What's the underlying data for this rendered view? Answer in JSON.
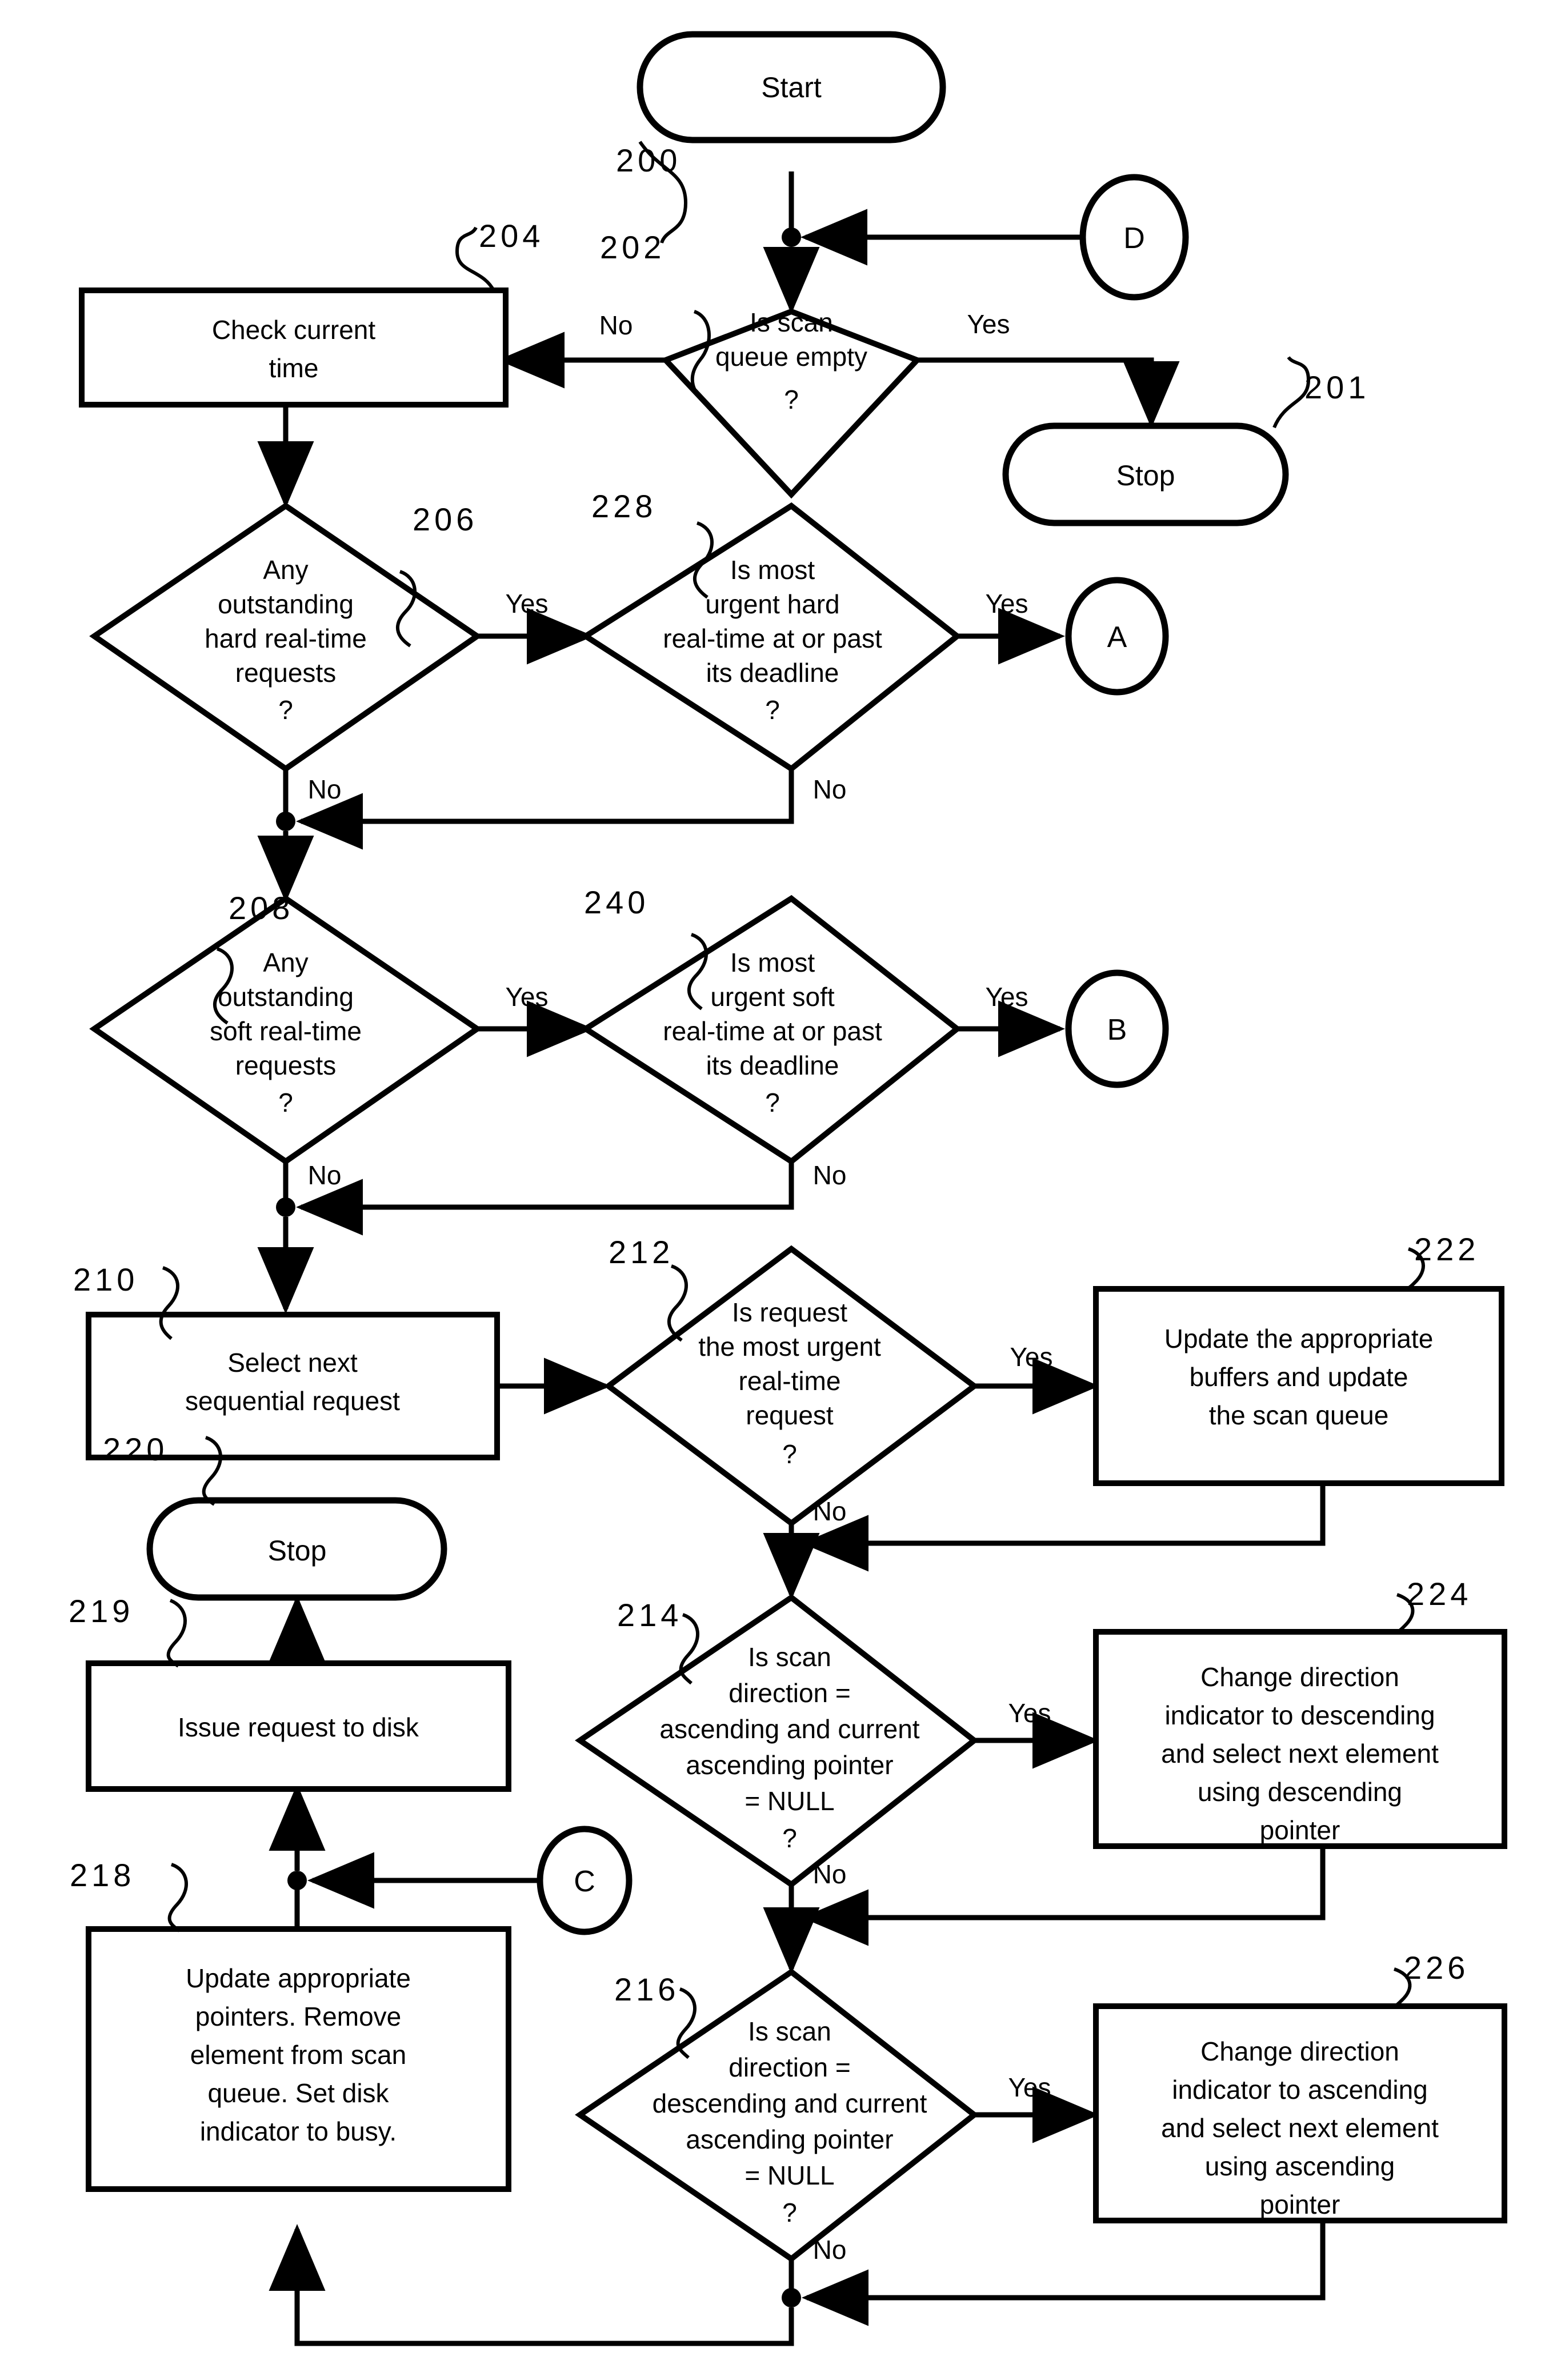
{
  "figure": {
    "type": "patent-flowchart",
    "title": "Disk request scheduling flowchart"
  },
  "nodes": {
    "start": {
      "ref": "200",
      "label": "Start",
      "shape": "terminator"
    },
    "stop_201": {
      "ref": "201",
      "label": "Stop",
      "shape": "terminator"
    },
    "d_connector": {
      "label": "D",
      "shape": "connector"
    },
    "dec_202": {
      "ref": "202",
      "shape": "decision",
      "lines": [
        "Is scan",
        "queue empty",
        "?"
      ]
    },
    "proc_204": {
      "ref": "204",
      "shape": "process",
      "lines": [
        "Check current",
        "time"
      ]
    },
    "dec_206": {
      "ref": "206",
      "shape": "decision",
      "lines": [
        "Any",
        "outstanding",
        "hard real-time",
        "requests",
        "?"
      ]
    },
    "dec_228": {
      "ref": "228",
      "shape": "decision",
      "lines": [
        "Is most",
        "urgent hard",
        "real-time at or past",
        "its deadline",
        "?"
      ]
    },
    "a_connector": {
      "label": "A",
      "shape": "connector"
    },
    "dec_208": {
      "ref": "208",
      "shape": "decision",
      "lines": [
        "Any",
        "outstanding",
        "soft real-time",
        "requests",
        "?"
      ]
    },
    "dec_240": {
      "ref": "240",
      "shape": "decision",
      "lines": [
        "Is most",
        "urgent soft",
        "real-time at or past",
        "its deadline",
        "?"
      ]
    },
    "b_connector": {
      "label": "B",
      "shape": "connector"
    },
    "proc_210": {
      "ref": "210",
      "shape": "process",
      "lines": [
        "Select next",
        "sequential request"
      ]
    },
    "dec_212": {
      "ref": "212",
      "shape": "decision",
      "lines": [
        "Is request",
        "the most urgent",
        "real-time",
        "request",
        "?"
      ]
    },
    "proc_222": {
      "ref": "222",
      "shape": "process",
      "lines": [
        "Update the appropriate",
        "buffers and update",
        "the scan queue"
      ]
    },
    "dec_214": {
      "ref": "214",
      "shape": "decision",
      "lines": [
        "Is scan",
        "direction =",
        "ascending and current",
        "ascending pointer",
        "= NULL",
        "?"
      ]
    },
    "proc_224": {
      "ref": "224",
      "shape": "process",
      "lines": [
        "Change direction",
        "indicator to descending",
        "and select next element",
        "using descending",
        "pointer"
      ]
    },
    "dec_216": {
      "ref": "216",
      "shape": "decision",
      "lines": [
        "Is scan",
        "direction =",
        "descending and current",
        "ascending pointer",
        "= NULL",
        "?"
      ]
    },
    "proc_226": {
      "ref": "226",
      "shape": "process",
      "lines": [
        "Change direction",
        "indicator to ascending",
        "and select next element",
        "using ascending",
        "pointer"
      ]
    },
    "stop_220": {
      "ref": "220",
      "label": "Stop",
      "shape": "terminator"
    },
    "proc_219": {
      "ref": "219",
      "shape": "process",
      "lines": [
        "Issue request to disk"
      ]
    },
    "proc_218": {
      "ref": "218",
      "shape": "process",
      "lines": [
        "Update appropriate",
        "pointers. Remove",
        "element from scan",
        "queue. Set disk",
        "indicator to busy."
      ]
    },
    "c_connector": {
      "label": "C",
      "shape": "connector"
    }
  },
  "edge_labels": {
    "no_202": "No",
    "yes_202": "Yes",
    "yes_206": "Yes",
    "no_206": "No",
    "yes_228": "Yes",
    "no_228": "No",
    "yes_208": "Yes",
    "no_208": "No",
    "yes_240": "Yes",
    "no_240": "No",
    "yes_212": "Yes",
    "no_212": "No",
    "yes_214": "Yes",
    "no_214": "No",
    "yes_216": "Yes",
    "no_216": "No"
  },
  "reference_numerals": [
    "200",
    "201",
    "202",
    "204",
    "206",
    "208",
    "210",
    "212",
    "214",
    "216",
    "218",
    "219",
    "220",
    "222",
    "224",
    "226",
    "228",
    "240"
  ],
  "colors": {
    "ink": "#000000",
    "paper": "#ffffff"
  }
}
